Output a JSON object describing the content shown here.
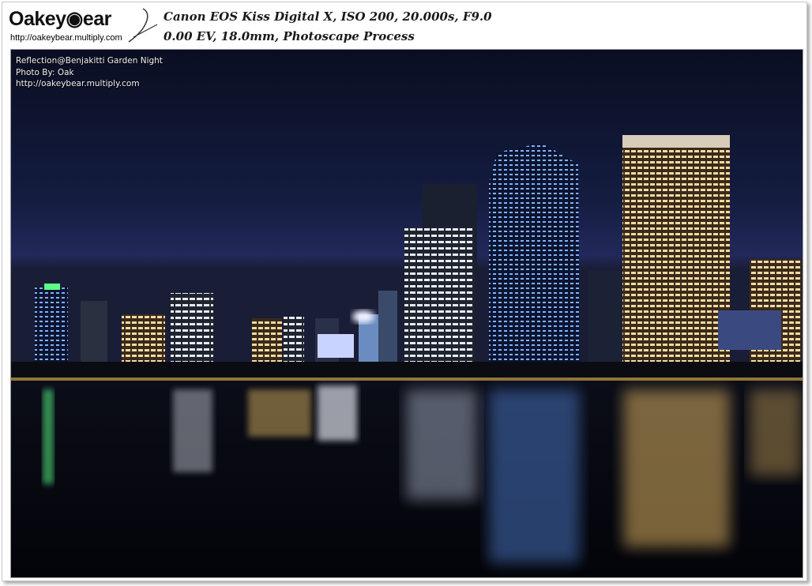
{
  "logo": {
    "brand_text": "Oakey◉ear",
    "url_text": "http://oakeybear.multiply.com"
  },
  "caption": {
    "line1": "Canon EOS Kiss Digital X, ISO 200, 20.000s, F9.0",
    "line2": "0.00 EV, 18.0mm, Photoscape Process"
  },
  "overlay": {
    "title": "Reflection@Benjakitti Garden Night",
    "credit": "Photo By: Oak",
    "url": "http://oakeybear.multiply.com"
  },
  "colors": {
    "sky_top": "#0b0f24",
    "water": "#05070f",
    "warm_light": "#f2c36b",
    "cool_light": "#8fc8ff"
  }
}
